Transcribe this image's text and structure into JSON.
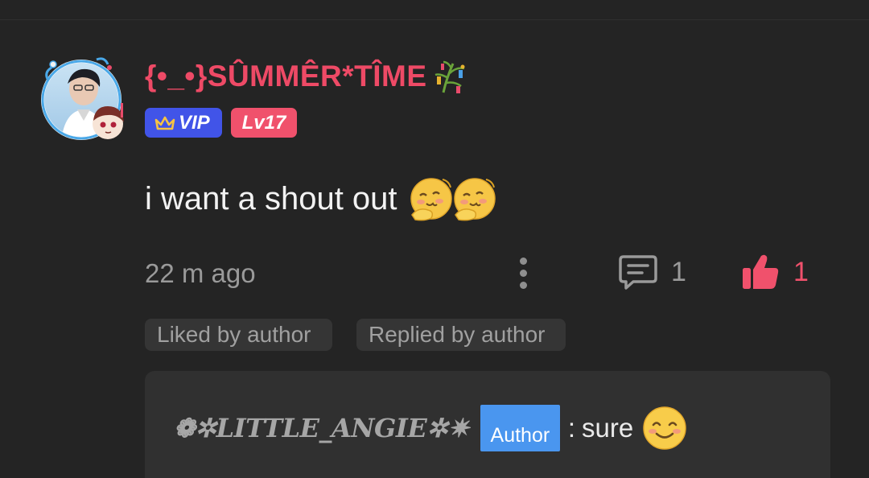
{
  "comment": {
    "username": "{•_•}SÛMMÊR*TÎME",
    "username_decoration_icon": "tanabata-tree-icon",
    "badges": {
      "vip_label": "VIP",
      "vip_icon": "crown-icon",
      "level_label": "Lv17"
    },
    "message": "i want a shout out",
    "message_emojis": [
      "thinking-smile-emoji",
      "thinking-smile-emoji"
    ],
    "timestamp": "22 m ago",
    "reply_count": "1",
    "like_count": "1",
    "tags": {
      "liked": "Liked by author",
      "replied": "Replied by author"
    }
  },
  "reply": {
    "author": "❁✲LITTLE_ANGIE✲✷",
    "author_badge": "Author",
    "colon": ":",
    "text": "sure",
    "emoji": "smiling-face-emoji"
  },
  "colors": {
    "background": "#242424",
    "username": "#ee4a66",
    "vip_badge": "#4154e8",
    "level_badge": "#f0516c",
    "like_accent": "#f0516c",
    "author_badge": "#4a96ef",
    "reply_box": "#303030"
  }
}
